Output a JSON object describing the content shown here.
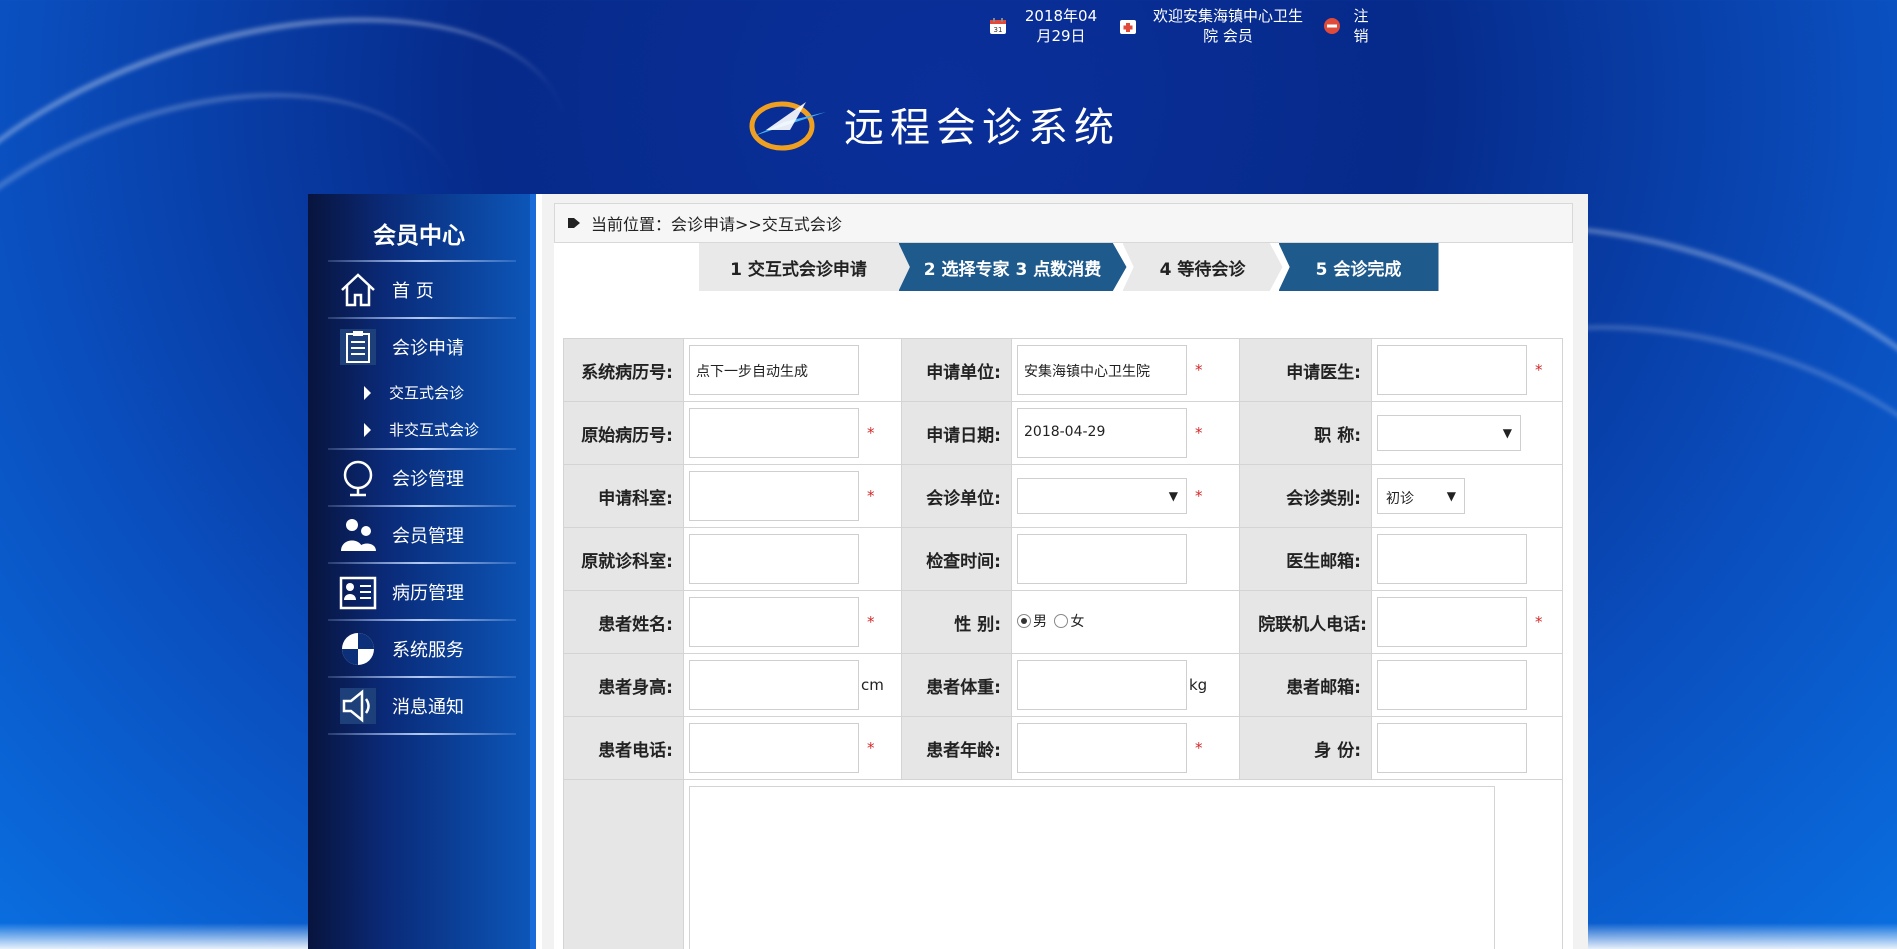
{
  "topbar": {
    "date": "2018年04月29日",
    "welcome": "欢迎安集海镇中心卫生院 会员",
    "logout": "注销"
  },
  "logo": {
    "title": "远程会诊系统"
  },
  "sidebar": {
    "title": "会员中心",
    "items": [
      {
        "label": "首 页",
        "icon": "home-icon"
      },
      {
        "label": "会诊申请",
        "icon": "clipboard-icon"
      },
      {
        "label": "会诊管理",
        "icon": "globe-icon"
      },
      {
        "label": "会员管理",
        "icon": "users-icon"
      },
      {
        "label": "病历管理",
        "icon": "id-card-icon"
      },
      {
        "label": "系统服务",
        "icon": "shield-icon"
      },
      {
        "label": "消息通知",
        "icon": "speaker-icon"
      }
    ],
    "subitems": [
      {
        "label": "交互式会诊"
      },
      {
        "label": "非交互式会诊"
      }
    ]
  },
  "breadcrumb": "当前位置：会诊申请>>交互式会诊",
  "steps": [
    "1 交互式会诊申请",
    "2 选择专家 3 点数消费",
    "4 等待会诊",
    "5 会诊完成"
  ],
  "form": {
    "labels": {
      "record_no": "系统病历号:",
      "apply_unit": "申请单位:",
      "apply_doctor": "申请医生:",
      "orig_record": "原始病历号:",
      "apply_date": "申请日期:",
      "title": "职 称:",
      "apply_dept": "申请科室:",
      "consult_unit": "会诊单位:",
      "consult_type": "会诊类别:",
      "orig_dept": "原就诊科室:",
      "exam_time": "检查时间:",
      "doctor_email": "医生邮箱:",
      "patient_name": "患者姓名:",
      "gender": "性 别:",
      "contact_phone": "院联机人电话:",
      "height": "患者身高:",
      "weight": "患者体重:",
      "patient_email": "患者邮箱:",
      "patient_phone": "患者电话:",
      "patient_age": "患者年龄:",
      "identity": "身 份:"
    },
    "values": {
      "record_no": "点下一步自动生成",
      "apply_unit": "安集海镇中心卫生院",
      "apply_date": "2018-04-29",
      "consult_type": "初诊",
      "gender_male": "男",
      "gender_female": "女",
      "height_unit": "cm",
      "weight_unit": "kg"
    },
    "required_mark": "*"
  }
}
